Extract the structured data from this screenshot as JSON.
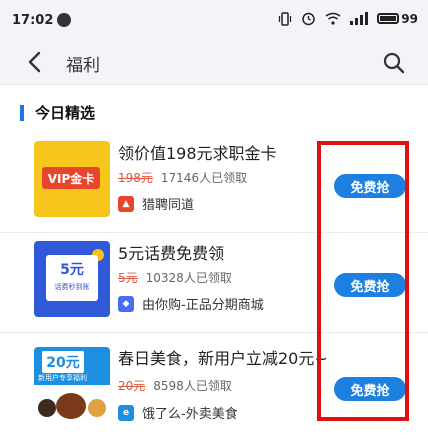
{
  "status_bar": {
    "time": "17:02",
    "battery": "99"
  },
  "nav": {
    "title": "福利"
  },
  "section": {
    "title": "今日精选"
  },
  "items": [
    {
      "title": "领价值198元求职金卡",
      "old_price": "198元",
      "claimed": "17146人已领取",
      "merchant": "猎聘同道",
      "thumb_label": "VIP金卡",
      "button": "免费抢",
      "logo_color": "#e8452d"
    },
    {
      "title": "5元话费免费领",
      "old_price": "5元",
      "claimed": "10328人已领取",
      "merchant": "由你购-正品分期商城",
      "thumb_amount": "5元",
      "thumb_sub": "话费秒到账",
      "button": "免费抢",
      "logo_color": "#4a6cf0"
    },
    {
      "title": "春日美食，新用户立减20元~",
      "old_price": "20元",
      "claimed": "8598人已领取",
      "merchant": "饿了么-外卖美食",
      "thumb_amount": "20元",
      "thumb_sub": "新用户专享福利",
      "button": "免费抢",
      "logo_color": "#1d8fe0"
    }
  ],
  "colors": {
    "accent": "#1d7fe0",
    "highlight": "#e01010",
    "price": "#e0563d"
  }
}
